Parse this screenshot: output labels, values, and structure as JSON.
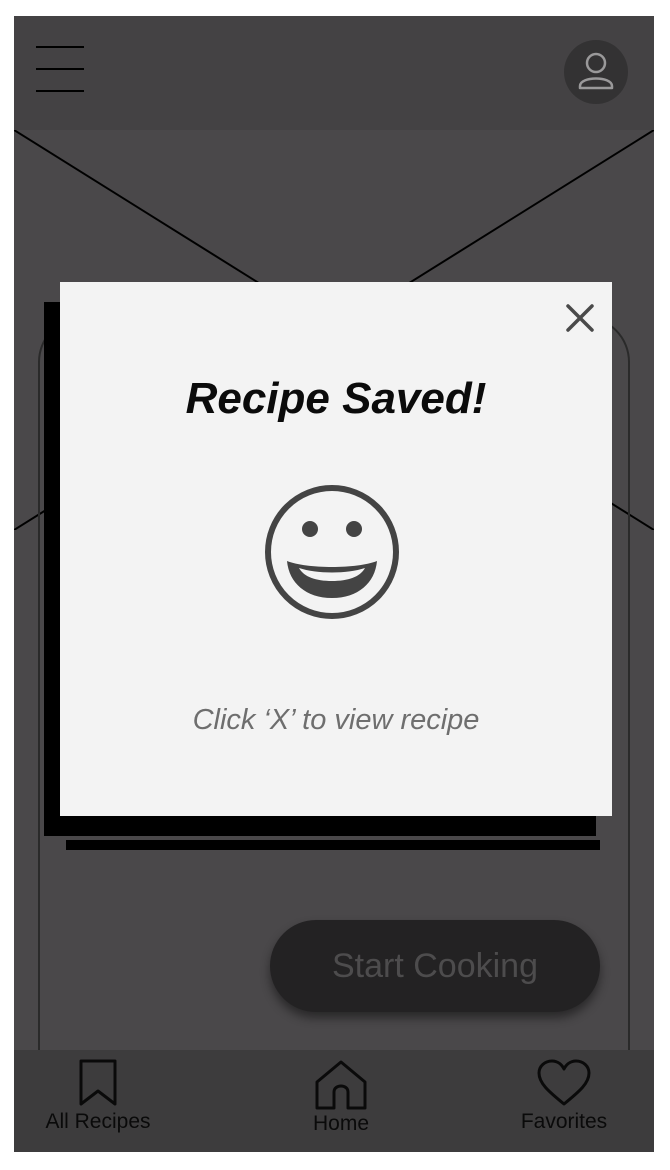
{
  "header": {
    "menu_icon": "hamburger-menu-icon",
    "profile_icon": "user-profile-icon"
  },
  "main": {
    "hero_image_icon": "image-placeholder-icon",
    "start_cooking_label": "Start Cooking"
  },
  "modal": {
    "title": "Recipe Saved!",
    "close_icon": "close-icon",
    "illustration_icon": "smiley-face-icon",
    "hint": "Click ‘X’ to view recipe"
  },
  "tabbar": {
    "items": [
      {
        "label": "All Recipes",
        "icon": "bookmark-icon"
      },
      {
        "label": "Home",
        "icon": "home-icon"
      },
      {
        "label": "Favorites",
        "icon": "heart-icon"
      }
    ]
  },
  "colors": {
    "screen_background": "#4a484a",
    "header_background": "#444244",
    "tabbar_background": "#3d3c3d",
    "modal_background": "#f3f3f3",
    "button_background": "#232223"
  }
}
